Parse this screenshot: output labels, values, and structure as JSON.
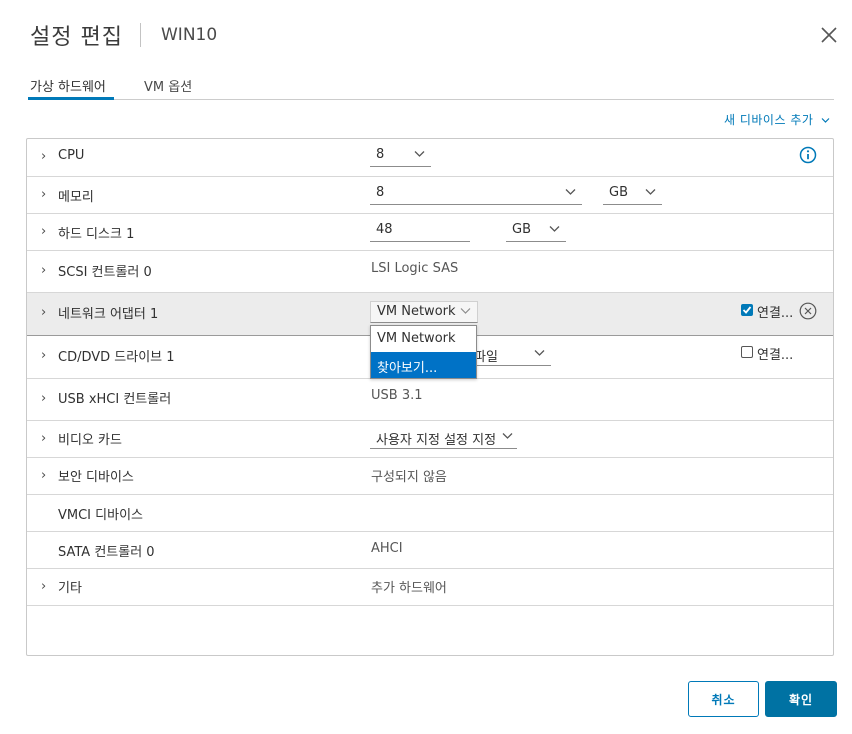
{
  "dialog": {
    "title": "설정 편집",
    "subtitle": "WIN10"
  },
  "tabs": [
    {
      "label": "가상 하드웨어",
      "active": true
    },
    {
      "label": "VM 옵션",
      "active": false
    }
  ],
  "add_device": "새 디바이스 추가",
  "rows": {
    "cpu": {
      "label": "CPU",
      "value": "8"
    },
    "memory": {
      "label": "메모리",
      "value": "8",
      "unit": "GB"
    },
    "disk": {
      "label": "하드 디스크 1",
      "value": "48",
      "unit": "GB"
    },
    "scsi": {
      "label": "SCSI 컨트롤러 0",
      "value": "LSI Logic SAS"
    },
    "nic": {
      "label": "네트워크 어댑터 1",
      "value": "VM Network",
      "connect": "연결...",
      "connected": true
    },
    "dvd": {
      "label": "CD/DVD 드라이브 1",
      "value": "파일",
      "connect": "연결...",
      "connected": false
    },
    "usb": {
      "label": "USB xHCI 컨트롤러",
      "value": "USB 3.1"
    },
    "video": {
      "label": "비디오 카드",
      "value": "사용자 지정 설정 지정"
    },
    "security": {
      "label": "보안 디바이스",
      "value": "구성되지 않음"
    },
    "vmci": {
      "label": "VMCI 디바이스"
    },
    "sata": {
      "label": "SATA 컨트롤러 0",
      "value": "AHCI"
    },
    "other": {
      "label": "기타",
      "value": "추가 하드웨어"
    }
  },
  "network_dropdown": {
    "options": [
      "VM Network",
      "찾아보기..."
    ],
    "highlighted": "찾아보기..."
  },
  "footer": {
    "cancel": "취소",
    "ok": "확인"
  },
  "colors": {
    "accent": "#0079b8",
    "primary_button": "#0072a3",
    "highlight_row": "#ececec",
    "selected_option": "#0072c6"
  }
}
